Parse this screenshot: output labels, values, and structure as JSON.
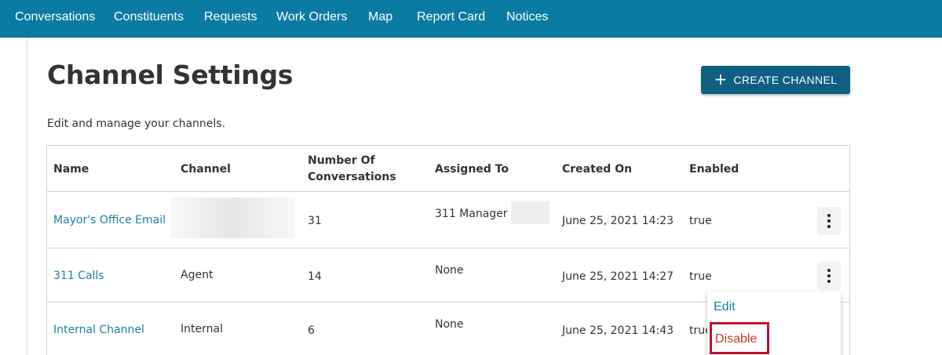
{
  "nav": {
    "items": [
      "Conversations",
      "Constituents",
      "Requests",
      "Work Orders",
      "Map",
      "Report Card",
      "Notices"
    ]
  },
  "page": {
    "title": "Channel Settings",
    "subtitle": "Edit and manage your channels.",
    "create_button": {
      "icon": "plus-icon",
      "label": "CREATE CHANNEL"
    }
  },
  "table": {
    "headers": {
      "name": "Name",
      "channel": "Channel",
      "num_conv_1": "Number Of",
      "num_conv_2": "Conversations",
      "assigned": "Assigned To",
      "created": "Created On",
      "enabled": "Enabled"
    },
    "rows": [
      {
        "name": "Mayor's Office Email",
        "channel": "",
        "conversations": "31",
        "assigned_to": "311 Manager",
        "created_on": "June 25, 2021 14:23",
        "enabled": "true"
      },
      {
        "name": "311 Calls",
        "channel": "Agent",
        "conversations": "14",
        "assigned_to": "None",
        "created_on": "June 25, 2021 14:27",
        "enabled": "true"
      },
      {
        "name": "Internal Channel",
        "channel": "Internal",
        "conversations": "6",
        "assigned_to": "None",
        "created_on": "June 25, 2021 14:43",
        "enabled": "true"
      }
    ]
  },
  "row_menu": {
    "edit": "Edit",
    "disable": "Disable",
    "highlight_color": "#c40c2e"
  },
  "colors": {
    "nav_bg": "#0a7ba3",
    "button_bg": "#0e5f82",
    "link": "#1a7fa6"
  }
}
